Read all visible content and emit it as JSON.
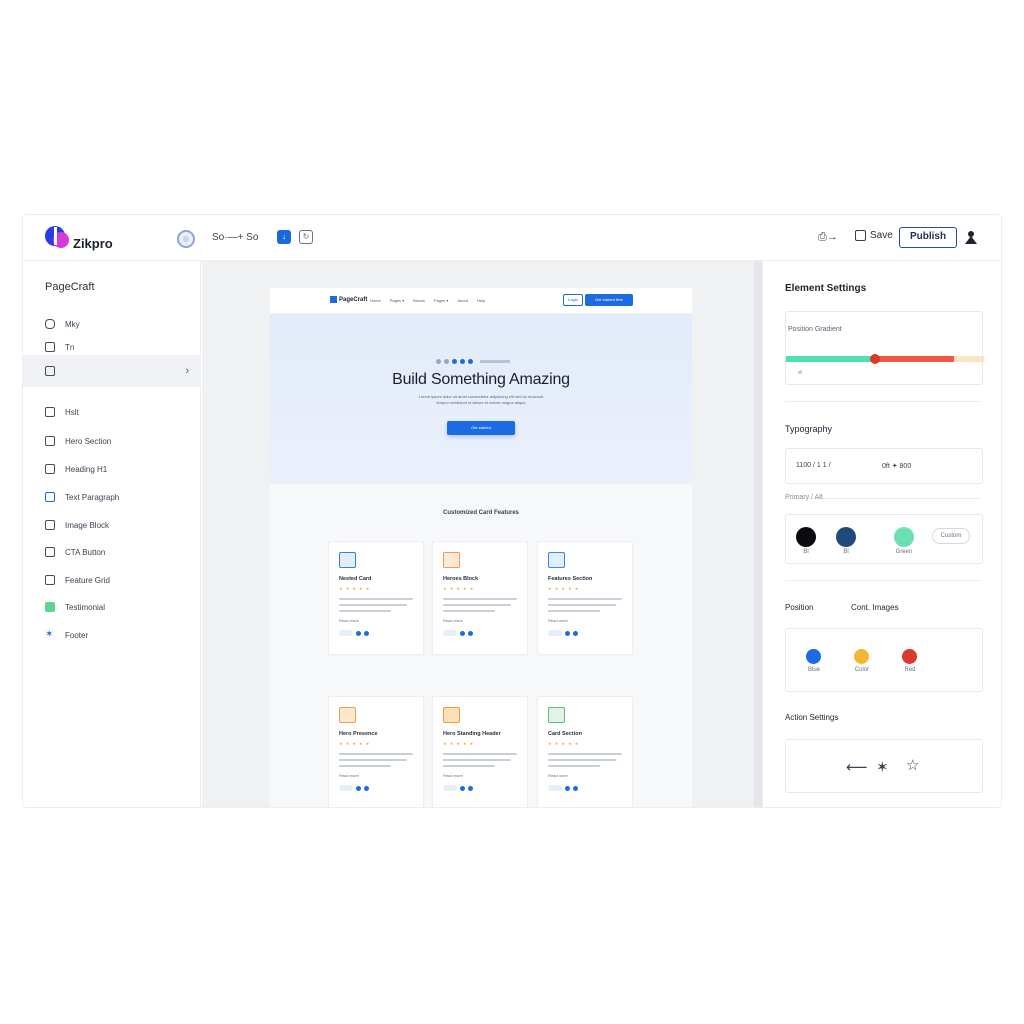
{
  "app": {
    "brand": "Zikpro",
    "page_selector": "Sᴏ·—+ Sᴏ",
    "toolbar_btn_blue": "↓",
    "toolbar_btn_out": "↻",
    "preview": "⎙→",
    "save_label": "Save",
    "publish_label": "Publish"
  },
  "sidebar": {
    "title": "PageCraft",
    "items": [
      {
        "label": "Mky"
      },
      {
        "label": "Tn"
      },
      {
        "label": ""
      },
      {
        "label": "Hslt"
      },
      {
        "label": "Hero Section"
      },
      {
        "label": "Heading H1"
      },
      {
        "label": "Text Paragraph"
      },
      {
        "label": "Image Block"
      },
      {
        "label": "CTA Button"
      },
      {
        "label": "Feature Grid"
      },
      {
        "label": "Testimonial"
      },
      {
        "label": "Footer"
      }
    ]
  },
  "preview_page": {
    "nav": {
      "logo": "PageCraft",
      "links": [
        "Home",
        "Pages ▾",
        "Blocks",
        "Pages ▾",
        "About",
        "Help"
      ],
      "login": "Login",
      "cta": "Get started free"
    },
    "hero": {
      "title": "Build Something Amazing",
      "subtitle_1": "Lorem ipsum dolor sit amet consectetur adipiscing elit sed do eiusmod",
      "subtitle_2": "tempor incididunt ut labore et dolore magna aliqua",
      "button": "Get started"
    },
    "section_title": "Customized Card Features",
    "cards": [
      {
        "title": "Nested Card",
        "icon_color": "#2f7fe8",
        "icon_bg": "#e3eefc"
      },
      {
        "title": "Heroes Block",
        "icon_color": "#f29a4a",
        "icon_bg": "#fde9d6"
      },
      {
        "title": "Features Section",
        "icon_color": "#3a86e8",
        "icon_bg": "#e2eefc"
      },
      {
        "title": "Hero Presence",
        "icon_color": "#f0a04b",
        "icon_bg": "#fde7cf"
      },
      {
        "title": "Hero Standing Header",
        "icon_color": "#f19a3e",
        "icon_bg": "#fddfba"
      },
      {
        "title": "Card Section",
        "icon_color": "#5bbd76",
        "icon_bg": "#e1f4e6"
      }
    ],
    "card_more": "Read more",
    "card_stars": "★ ★ ★ ★ ★"
  },
  "settings": {
    "title": "Element Settings",
    "gradient_label": "Position Gradient",
    "gradient_value": "w",
    "typography_title": "Typography",
    "typo_size": "1100  / 1 1 /",
    "typo_weight": "0ft  ✦ 800",
    "colors_label": "Primary / Alt",
    "colors": [
      {
        "color": "#0b0b0f",
        "label": "Bl"
      },
      {
        "color": "#1e4b7a",
        "label": "Bl"
      },
      {
        "color": "#6be0b6",
        "label": "Green"
      }
    ],
    "colors_more": "Custom",
    "position_label": "Position",
    "cont_label": "Cont. Images",
    "accents": [
      {
        "color": "#1d6be3",
        "label": "Blue"
      },
      {
        "color": "#f5b731",
        "label": "Color"
      },
      {
        "color": "#d93a2e",
        "label": "Red"
      }
    ],
    "action_title": "Action Settings",
    "actions": [
      "⟵",
      "✶",
      "☆"
    ]
  }
}
